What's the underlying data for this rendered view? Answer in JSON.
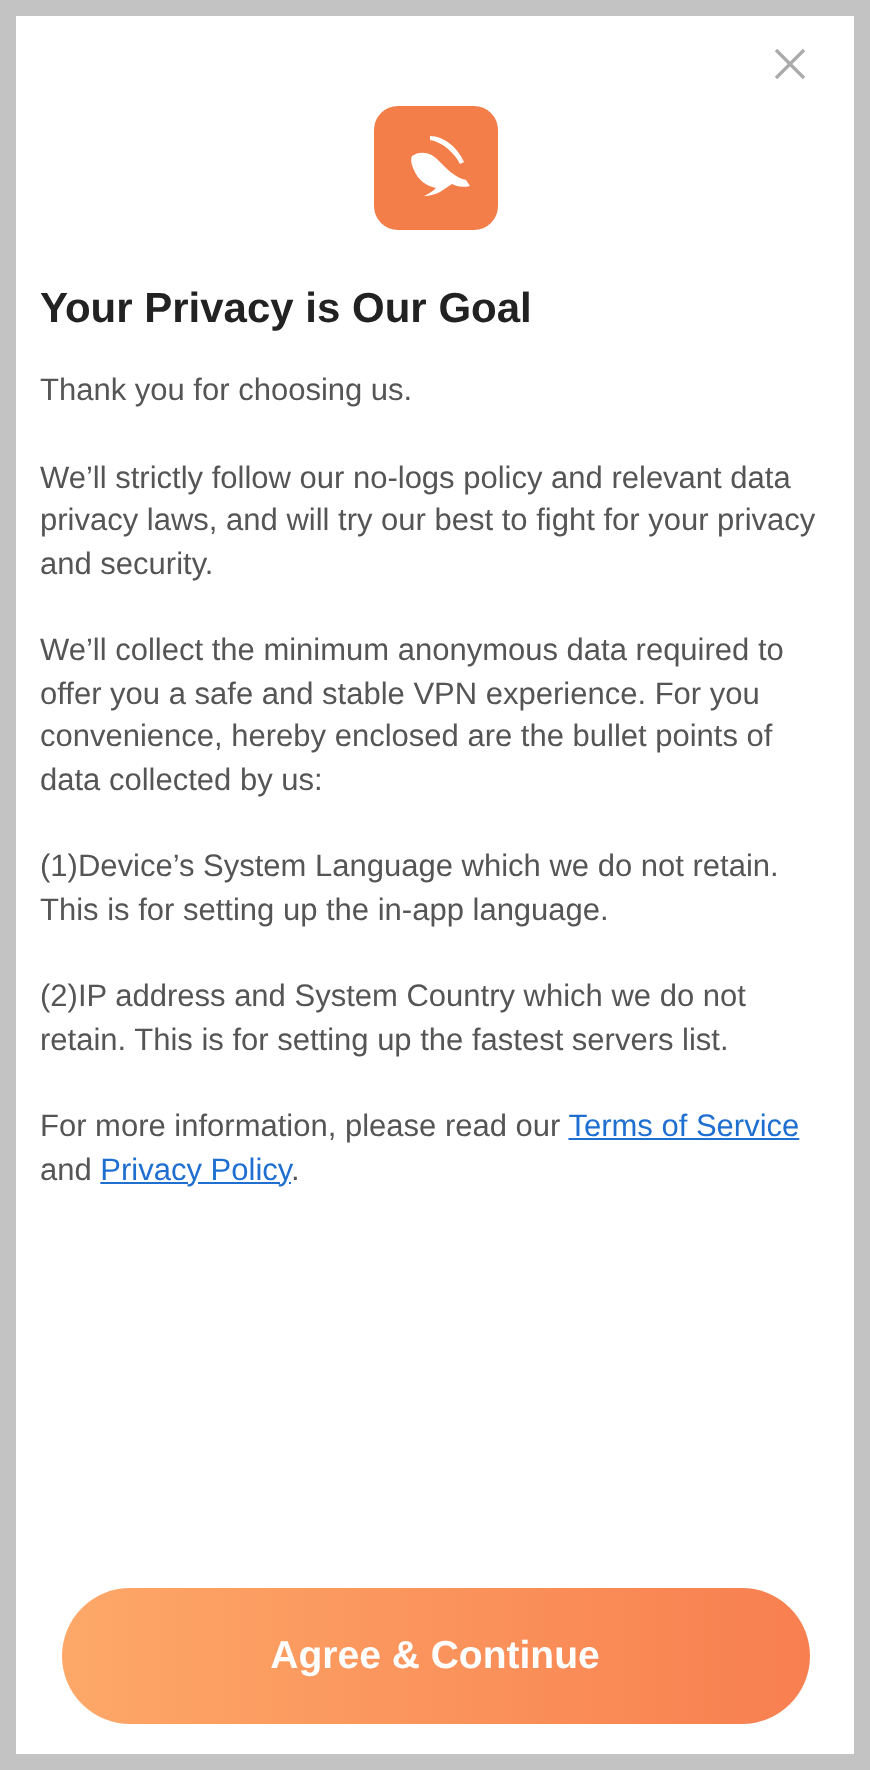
{
  "title": "Your Privacy is Our Goal",
  "paragraphs": [
    "Thank you for choosing us.",
    "We’ll strictly follow our no-logs policy and relevant data privacy laws, and will try our best to fight for your privacy and security.",
    "We’ll collect the minimum anonymous data required to offer you a safe and stable VPN experience. For you convenience, hereby enclosed are the bullet points of data collected by us:",
    "(1)Device’s System Language which we do not retain. This is for setting up the in-app language.",
    "(2)IP address and System Country which we do not retain. This is for setting up the fastest servers list."
  ],
  "footer": {
    "before": "For more information, please read our ",
    "terms_link": "Terms of Service",
    "middle": " and ",
    "privacy_link": "Privacy Policy",
    "after": "."
  },
  "button": "Agree & Continue"
}
